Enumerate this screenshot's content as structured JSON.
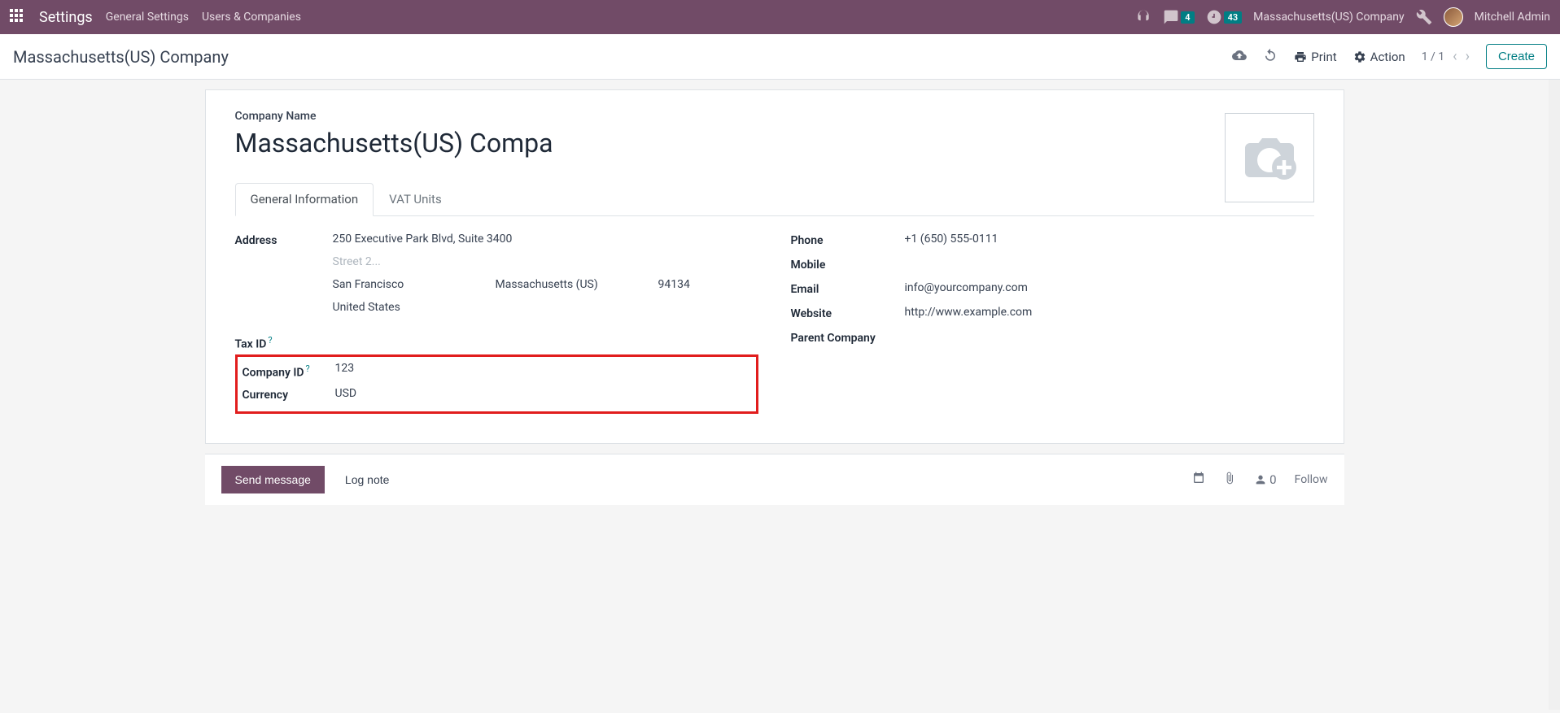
{
  "navbar": {
    "app_title": "Settings",
    "menu": {
      "general_settings": "General Settings",
      "users_companies": "Users & Companies"
    },
    "messages_badge": "4",
    "activities_badge": "43",
    "company": "Massachusetts(US) Company",
    "user": "Mitchell Admin"
  },
  "control_panel": {
    "breadcrumb": "Massachusetts(US) Company",
    "print": "Print",
    "action": "Action",
    "pager": "1 / 1",
    "create": "Create"
  },
  "form": {
    "company_name_label": "Company Name",
    "company_name_value": "Massachusetts(US) Compa",
    "tabs": {
      "general_info": "General Information",
      "vat_units": "VAT Units"
    },
    "left": {
      "address_label": "Address",
      "street": "250 Executive Park Blvd, Suite 3400",
      "street2_placeholder": "Street 2...",
      "city": "San Francisco",
      "state": "Massachusetts (US)",
      "zip": "94134",
      "country": "United States",
      "tax_id_label": "Tax ID",
      "company_id_label": "Company ID",
      "company_id_value": "123",
      "currency_label": "Currency",
      "currency_value": "USD"
    },
    "right": {
      "phone_label": "Phone",
      "phone_value": "+1 (650) 555-0111",
      "mobile_label": "Mobile",
      "mobile_value": "",
      "email_label": "Email",
      "email_value": "info@yourcompany.com",
      "website_label": "Website",
      "website_value": "http://www.example.com",
      "parent_company_label": "Parent Company",
      "parent_company_value": ""
    }
  },
  "chatter": {
    "send_message": "Send message",
    "log_note": "Log note",
    "followers": "0",
    "follow": "Follow"
  }
}
